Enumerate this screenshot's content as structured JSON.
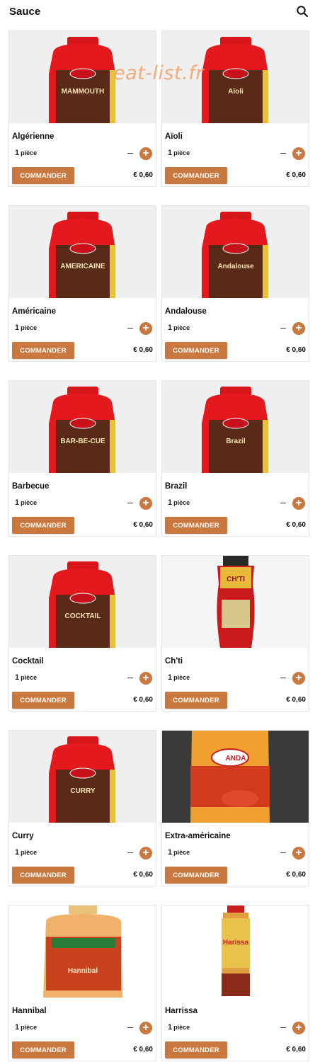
{
  "header": {
    "title": "Sauce",
    "search_icon": "search-icon"
  },
  "watermark": "eat-list.fr",
  "colors": {
    "accent": "#c9783f",
    "bottle_red": "#e02020",
    "label_dark": "#5a2a18",
    "text": "#111111"
  },
  "products": [
    {
      "name": "Algérienne",
      "qty": "1",
      "unit": "pièce",
      "order_label": "COMMANDER",
      "price": "€ 0,60",
      "label_text": "MAMMOUTH",
      "image": "red-jar"
    },
    {
      "name": "Aïoli",
      "qty": "1",
      "unit": "pièce",
      "order_label": "COMMANDER",
      "price": "€ 0,60",
      "label_text": "Aïoli",
      "image": "red-jar"
    },
    {
      "name": "Américaine",
      "qty": "1",
      "unit": "pièce",
      "order_label": "COMMANDER",
      "price": "€ 0,60",
      "label_text": "AMERICAINE",
      "image": "red-jar"
    },
    {
      "name": "Andalouse",
      "qty": "1",
      "unit": "pièce",
      "order_label": "COMMANDER",
      "price": "€ 0,60",
      "label_text": "Andalouse",
      "image": "red-jar"
    },
    {
      "name": "Barbecue",
      "qty": "1",
      "unit": "pièce",
      "order_label": "COMMANDER",
      "price": "€ 0,60",
      "label_text": "BAR-BE-CUE",
      "image": "red-jar"
    },
    {
      "name": "Brazil",
      "qty": "1",
      "unit": "pièce",
      "order_label": "COMMANDER",
      "price": "€ 0,60",
      "label_text": "Brazil",
      "image": "red-jar"
    },
    {
      "name": "Cocktail",
      "qty": "1",
      "unit": "pièce",
      "order_label": "COMMANDER",
      "price": "€ 0,60",
      "label_text": "COCKTAIL",
      "image": "red-jar"
    },
    {
      "name": "Ch'ti",
      "qty": "1",
      "unit": "pièce",
      "order_label": "COMMANDER",
      "price": "€ 0,60",
      "label_text": "CH'TI",
      "image": "squeeze-bottle"
    },
    {
      "name": "Curry",
      "qty": "1",
      "unit": "pièce",
      "order_label": "COMMANDER",
      "price": "€ 0,60",
      "label_text": "CURRY",
      "image": "red-jar"
    },
    {
      "name": "Extra-américaine",
      "qty": "1",
      "unit": "pièce",
      "order_label": "COMMANDER",
      "price": "€ 0,60",
      "label_text": "ANDA",
      "image": "anda-bottle"
    },
    {
      "name": "Hannibal",
      "qty": "1",
      "unit": "pièce",
      "order_label": "COMMANDER",
      "price": "€ 0,60",
      "label_text": "Hannibal",
      "image": "orange-jar"
    },
    {
      "name": "Harrissa",
      "qty": "1",
      "unit": "pièce",
      "order_label": "COMMANDER",
      "price": "€ 0,60",
      "label_text": "Harissa",
      "image": "tall-bottle"
    }
  ]
}
